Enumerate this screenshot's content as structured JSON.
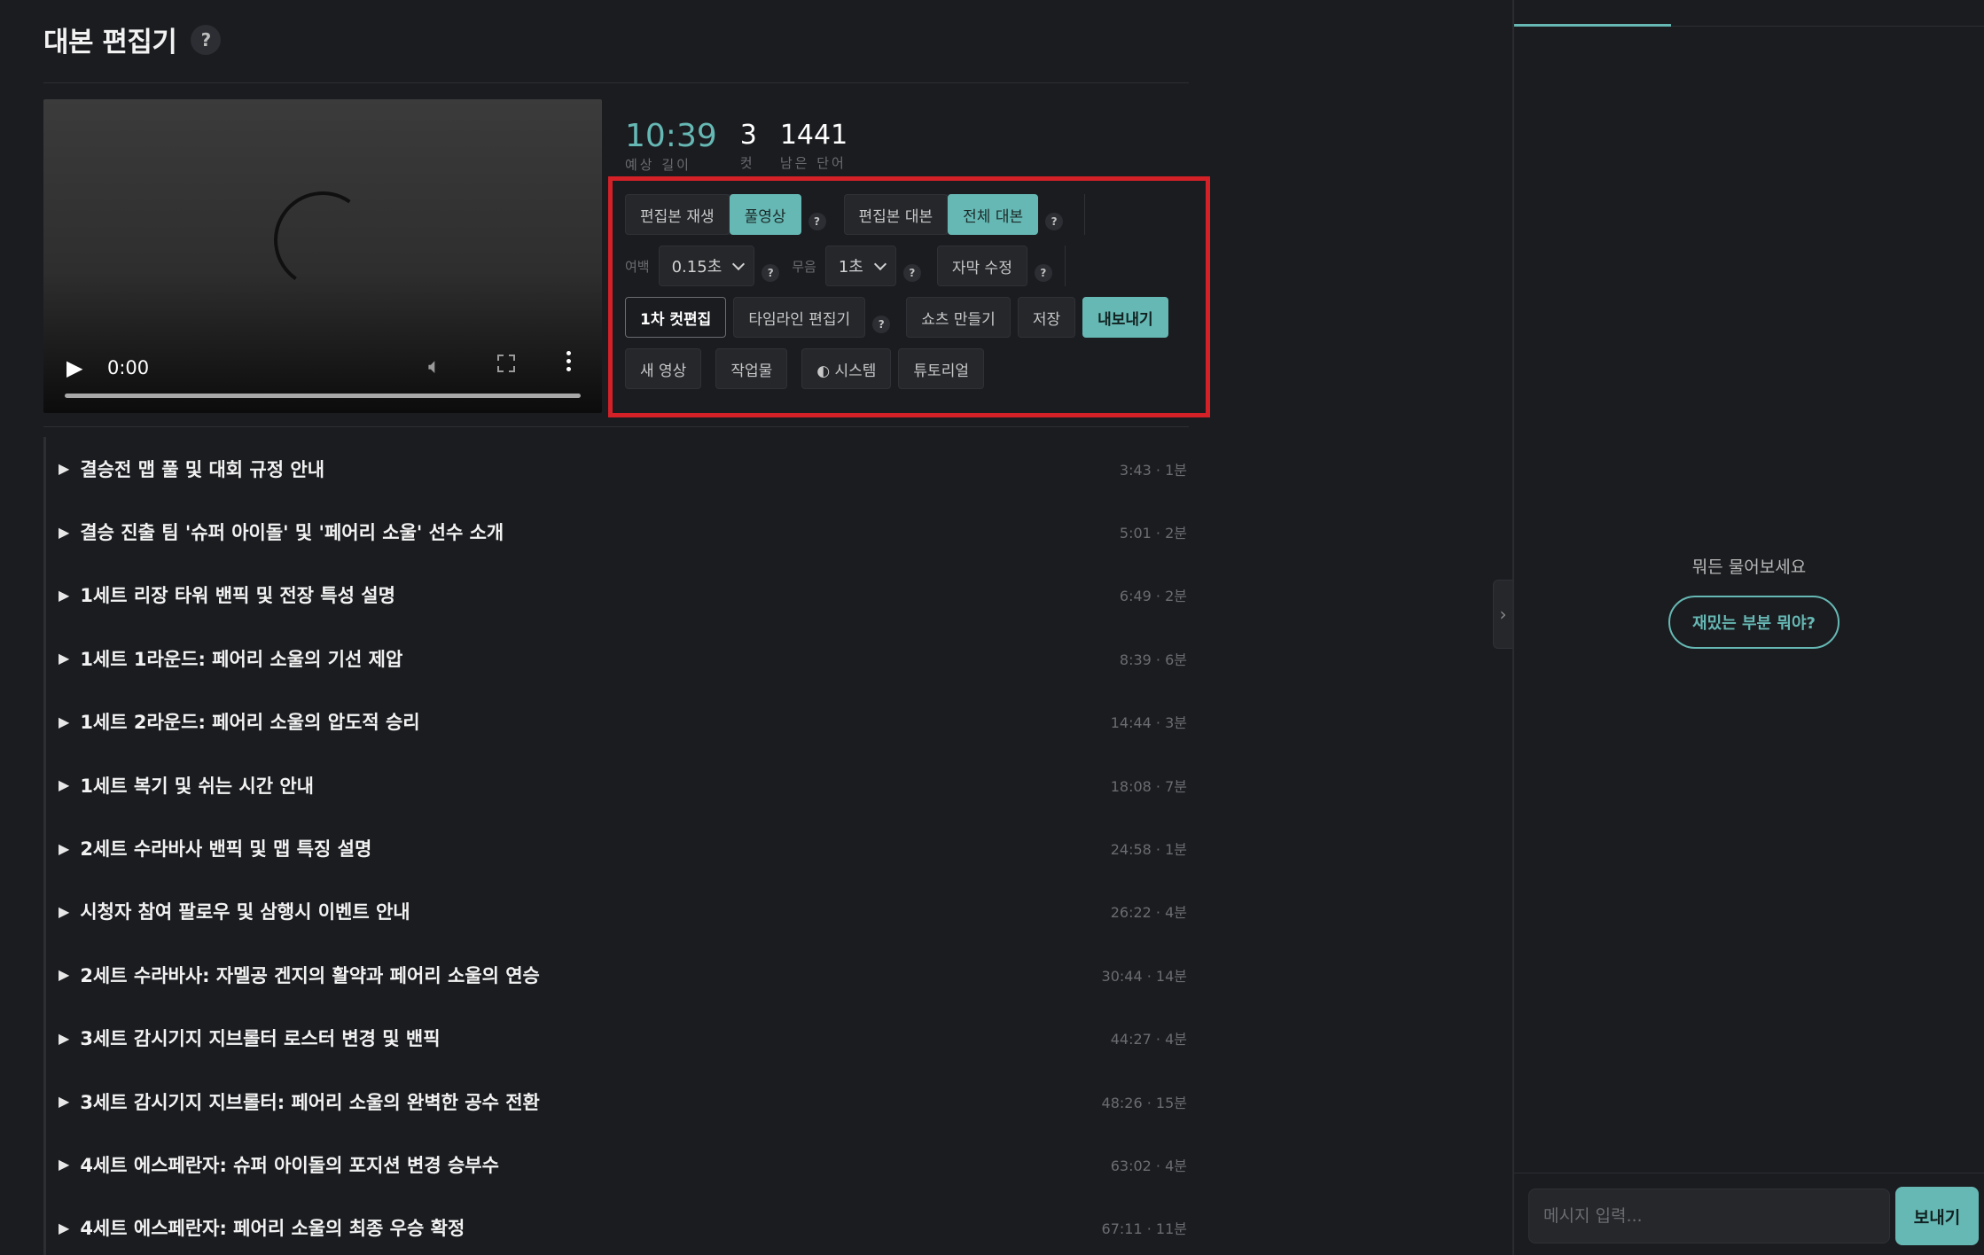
{
  "app": {
    "title": "대본 편집기",
    "help": "?"
  },
  "video": {
    "time": "0:00",
    "progress": 0
  },
  "stats": {
    "length_value": "10:39",
    "length_label": "예상 길이",
    "cuts_value": "3",
    "cuts_label": "컷",
    "words_value": "1441",
    "words_label": "남은 단어"
  },
  "controls": {
    "play_edited": "편집본 재생",
    "full_video": "풀영상",
    "edited_script": "편집본 대본",
    "full_script": "전체 대본",
    "margin_label": "여백",
    "margin_value": "0.15초",
    "silence_label": "무음",
    "silence_value": "1초",
    "subtitle_edit": "자막 수정",
    "first_cut": "1차 컷편집",
    "timeline_editor": "타임라인 편집기",
    "make_shorts": "쇼츠 만들기",
    "save": "저장",
    "export": "내보내기",
    "new_video": "새 영상",
    "works": "작업물",
    "system_theme": "◐ 시스템",
    "tutorial": "튜토리얼",
    "help": "?"
  },
  "chapters": [
    {
      "title": "결승전 맵 풀 및 대회 규정 안내",
      "meta": "3:43 · 1분"
    },
    {
      "title": "결승 진출 팀 '슈퍼 아이돌' 및 '페어리 소울' 선수 소개",
      "meta": "5:01 · 2분"
    },
    {
      "title": "1세트 리장 타워 밴픽 및 전장 특성 설명",
      "meta": "6:49 · 2분"
    },
    {
      "title": "1세트 1라운드: 페어리 소울의 기선 제압",
      "meta": "8:39 · 6분"
    },
    {
      "title": "1세트 2라운드: 페어리 소울의 압도적 승리",
      "meta": "14:44 · 3분"
    },
    {
      "title": "1세트 복기 및 쉬는 시간 안내",
      "meta": "18:08 · 7분"
    },
    {
      "title": "2세트 수라바사 밴픽 및 맵 특징 설명",
      "meta": "24:58 · 1분"
    },
    {
      "title": "시청자 참여 팔로우 및 삼행시 이벤트 안내",
      "meta": "26:22 · 4분"
    },
    {
      "title": "2세트 수라바사: 자멜공 겐지의 활약과 페어리 소울의 연승",
      "meta": "30:44 · 14분"
    },
    {
      "title": "3세트 감시기지 지브롤터 로스터 변경 및 밴픽",
      "meta": "44:27 · 4분"
    },
    {
      "title": "3세트 감시기지 지브롤터: 페어리 소울의 완벽한 공수 전환",
      "meta": "48:26 · 15분"
    },
    {
      "title": "4세트 에스페란자: 슈퍼 아이돌의 포지션 변경 승부수",
      "meta": "63:02 · 4분"
    },
    {
      "title": "4세트 에스페란자: 페어리 소울의 최종 우승 확정",
      "meta": "67:11 · 11분"
    }
  ],
  "chat": {
    "collapse_icon": "›",
    "empty_prompt": "뭐든 물어보세요",
    "suggestion": "재밌는 부분 뭐야?",
    "input_placeholder": "메시지 입력...",
    "send": "보내기"
  },
  "colors": {
    "background": "#1b1c20",
    "accent": "#66b8b4",
    "highlight_border": "#d42027"
  }
}
